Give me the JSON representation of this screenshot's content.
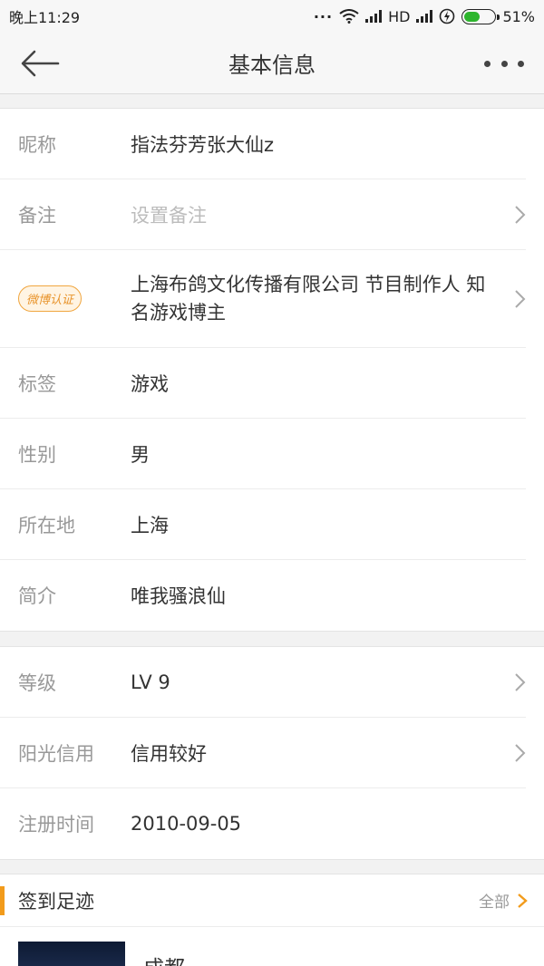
{
  "status_bar": {
    "time": "晚上11:29",
    "network": "HD",
    "battery": "51%",
    "battery_level": 0.51
  },
  "navbar": {
    "title": "基本信息",
    "back_icon": "arrow-left-icon",
    "more_icon": "more-horizontal-icon"
  },
  "basic_info": [
    {
      "label": "昵称",
      "value": "指法芬芳张大仙z",
      "placeholder": false,
      "chevron": false
    },
    {
      "label": "备注",
      "value": "设置备注",
      "placeholder": true,
      "chevron": true
    },
    {
      "label_badge": "微博认证",
      "value": "上海布鸽文化传播有限公司 节目制作人 知名游戏博主",
      "placeholder": false,
      "chevron": true
    },
    {
      "label": "标签",
      "value": "游戏",
      "placeholder": false,
      "chevron": false
    },
    {
      "label": "性别",
      "value": "男",
      "placeholder": false,
      "chevron": false
    },
    {
      "label": "所在地",
      "value": "上海",
      "placeholder": false,
      "chevron": false
    },
    {
      "label": "简介",
      "value": "唯我骚浪仙",
      "placeholder": false,
      "chevron": false
    }
  ],
  "account_info": [
    {
      "label": "等级",
      "value": "LV 9",
      "chevron": true
    },
    {
      "label": "阳光信用",
      "value": "信用较好",
      "chevron": true
    },
    {
      "label": "注册时间",
      "value": "2010-09-05",
      "chevron": false
    }
  ],
  "footprint": {
    "title": "签到足迹",
    "all_label": "全部",
    "first_city": "成都"
  },
  "colors": {
    "accent": "#f29b1b",
    "badge_border": "#f0a640",
    "battery_green": "#2db52d"
  }
}
